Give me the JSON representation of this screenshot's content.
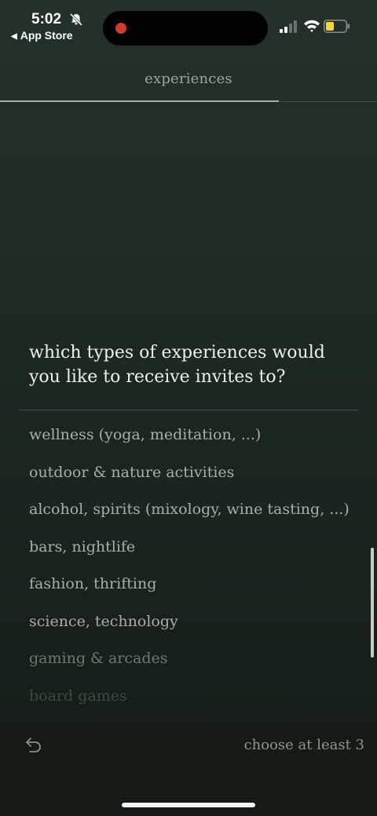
{
  "status_bar": {
    "time": "5:02",
    "back_app": "App Store",
    "back_arrow": "◀"
  },
  "header": {
    "title": "experiences",
    "progress": 0.74
  },
  "question": "which types of experiences would you like to receive invites to?",
  "options": [
    "wellness (yoga, meditation, ...)",
    "outdoor & nature activities",
    "alcohol, spirits (mixology, wine tasting, ...)",
    "bars, nightlife",
    "fashion, thrifting",
    "science, technology",
    "gaming & arcades",
    "board games"
  ],
  "footer": {
    "hint": "choose at least 3"
  },
  "colors": {
    "background": "#1f2a24",
    "recording_dot": "#d23a2f",
    "battery_fill": "#f5d33a"
  }
}
